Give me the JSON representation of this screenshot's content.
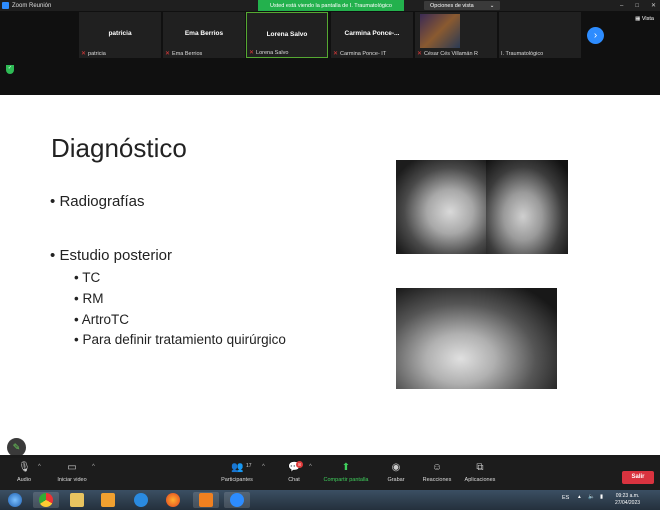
{
  "window": {
    "title": "Zoom Reunión"
  },
  "share_banner": {
    "text": "Usted está viendo la pantalla de I. Traumatológico"
  },
  "view_options": {
    "label": "Opciones de vista",
    "caret": "⌄"
  },
  "window_controls": {
    "minimize": "–",
    "maximize": "□",
    "close": "✕"
  },
  "participants": {
    "view_label": "Vista",
    "tiles": [
      {
        "name": "patricia",
        "label": "patricia"
      },
      {
        "name": "Ema Berrios",
        "label": "Ema Berrios"
      },
      {
        "name": "Lorena Salvo",
        "label": "Lorena Salvo"
      },
      {
        "name": "Carmina Ponce-...",
        "label": "Carmina Ponce- IT"
      },
      {
        "name": "",
        "label": "César Cés Villamán R"
      },
      {
        "name": "",
        "label": "I. Traumatológico"
      }
    ]
  },
  "slide": {
    "title": "Diagnóstico",
    "bullets": [
      {
        "level": 1,
        "text": "Radiografías"
      },
      {
        "level": 1,
        "text": "Estudio posterior"
      },
      {
        "level": 2,
        "text": "TC"
      },
      {
        "level": 2,
        "text": "RM"
      },
      {
        "level": 2,
        "text": "ArtroTC"
      },
      {
        "level": 2,
        "text": "Para definir tratamiento quirúrgico"
      }
    ],
    "bullet_char": "•"
  },
  "toolbar": {
    "audio": "Audio",
    "video": "Iniciar video",
    "participants": "Participantes",
    "participants_count": "17",
    "chat": "Chat",
    "chat_badge": "8",
    "share": "Compartir pantalla",
    "record": "Grabar",
    "reactions": "Reacciones",
    "apps": "Aplicaciones",
    "leave": "Salir"
  },
  "taskbar": {
    "lang": "ES",
    "time": "09:23 a.m.",
    "date": "27/04/2023"
  },
  "colors": {
    "share_banner": "#23b14d",
    "active_border": "#55a832",
    "nav_button": "#2d8cff",
    "leave_button": "#d9333f",
    "share_icon": "#3fcf5c"
  }
}
